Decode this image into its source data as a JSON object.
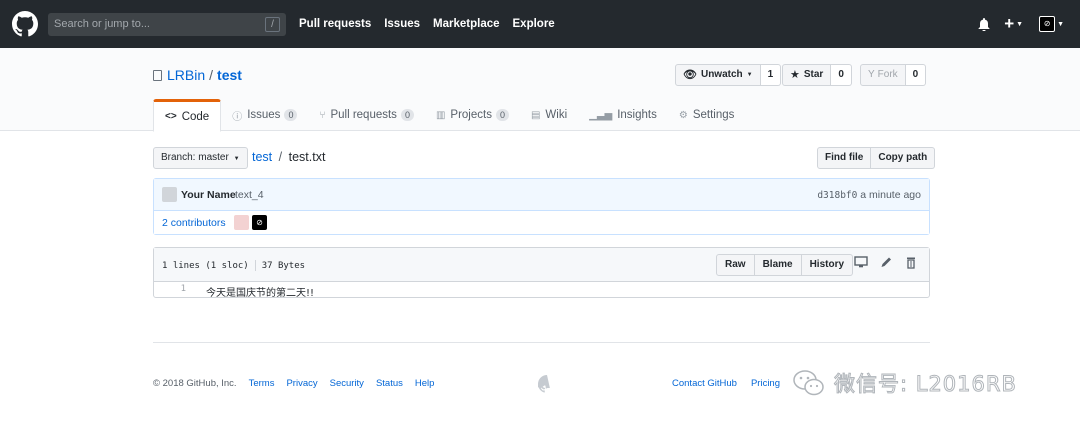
{
  "header": {
    "search_placeholder": "Search or jump to...",
    "search_key": "/",
    "nav": [
      "Pull requests",
      "Issues",
      "Marketplace",
      "Explore"
    ],
    "plus": "+"
  },
  "repo": {
    "owner": "LRBin",
    "name": "test",
    "unwatch_label": "Unwatch",
    "watch_count": "1",
    "star_label": "Star",
    "star_count": "0",
    "fork_label": "Fork",
    "fork_count": "0"
  },
  "tabs": [
    {
      "label": "Code",
      "icon": "<>",
      "count": null
    },
    {
      "label": "Issues",
      "icon": "issue-icon",
      "count": "0"
    },
    {
      "label": "Pull requests",
      "icon": "pr-icon",
      "count": "0"
    },
    {
      "label": "Projects",
      "icon": "project-icon",
      "count": "0"
    },
    {
      "label": "Wiki",
      "icon": "wiki-icon",
      "count": null
    },
    {
      "label": "Insights",
      "icon": "graph-icon",
      "count": null
    },
    {
      "label": "Settings",
      "icon": "gear-icon",
      "count": null
    }
  ],
  "filenav": {
    "branch_prefix": "Branch:",
    "branch": "master",
    "crumb_repo": "test",
    "crumb_file": "test.txt",
    "find_file": "Find file",
    "copy_path": "Copy path"
  },
  "commit": {
    "author": "Your Name",
    "message": "text_4",
    "sha": "d318bf0",
    "time": "a minute ago",
    "contributors": "2 contributors"
  },
  "file": {
    "lines": "1 lines (1 sloc)",
    "size": "37 Bytes",
    "raw": "Raw",
    "blame": "Blame",
    "history": "History",
    "line_number": "1",
    "content": "今天是国庆节的第二天!!"
  },
  "footer": {
    "copyright": "© 2018 GitHub, Inc.",
    "left_links": [
      "Terms",
      "Privacy",
      "Security",
      "Status",
      "Help"
    ],
    "right_links": [
      "Contact GitHub",
      "Pricing"
    ]
  },
  "watermark": "微信号: L2016RB"
}
